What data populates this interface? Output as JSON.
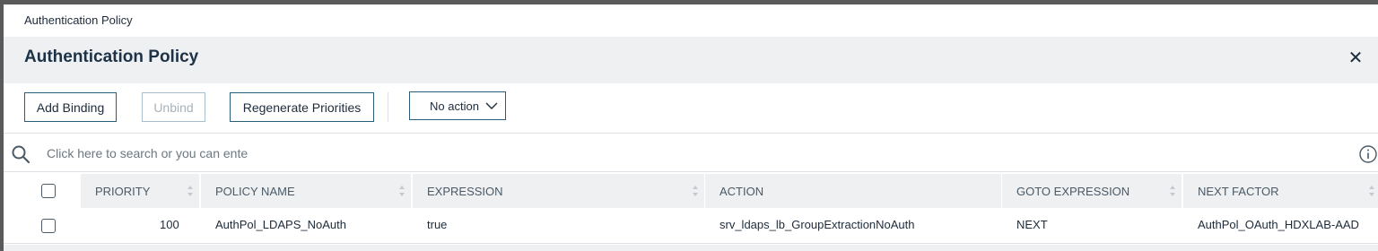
{
  "breadcrumb": "Authentication Policy",
  "header": {
    "title": "Authentication Policy"
  },
  "toolbar": {
    "add_binding": "Add Binding",
    "unbind": "Unbind",
    "regenerate": "Regenerate Priorities",
    "action_select": "No action"
  },
  "search": {
    "placeholder": "Click here to search or you can ente"
  },
  "table": {
    "columns": [
      "PRIORITY",
      "POLICY NAME",
      "EXPRESSION",
      "ACTION",
      "GOTO EXPRESSION",
      "NEXT FACTOR"
    ],
    "rows": [
      {
        "priority": "100",
        "policy_name": "AuthPol_LDAPS_NoAuth",
        "expression": "true",
        "action": "srv_ldaps_lb_GroupExtractionNoAuth",
        "goto": "NEXT",
        "next_factor": "AuthPol_OAuth_HDXLAB-AAD"
      }
    ]
  },
  "colors": {
    "accent": "#2a5d79",
    "header_bg": "#eef0f2"
  }
}
